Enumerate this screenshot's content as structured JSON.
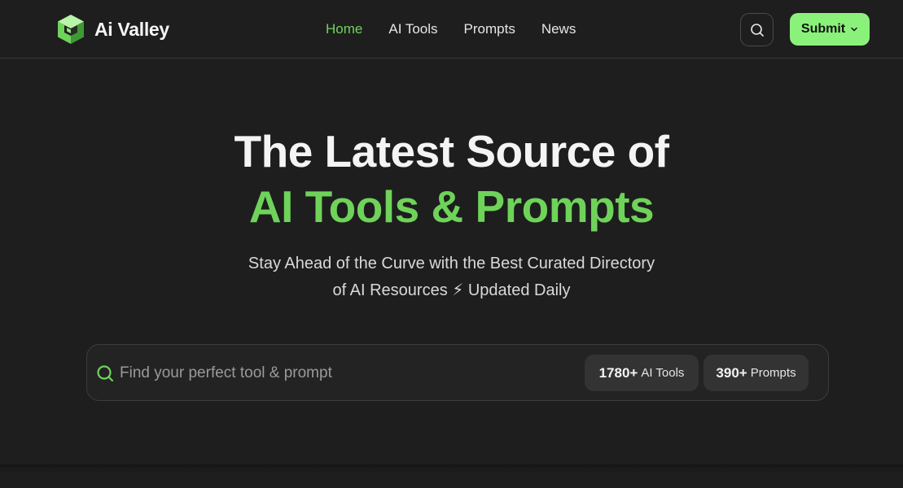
{
  "brand": {
    "name": "Ai Valley",
    "accent": "#6fd35a",
    "button_color": "#8af27a"
  },
  "nav": {
    "items": [
      {
        "label": "Home",
        "active": true
      },
      {
        "label": "AI Tools",
        "active": false
      },
      {
        "label": "Prompts",
        "active": false
      },
      {
        "label": "News",
        "active": false
      }
    ]
  },
  "header": {
    "search_icon": "search-icon",
    "submit_label": "Submit",
    "submit_icon": "chevron-down-icon"
  },
  "hero": {
    "title_line1": "The Latest Source of",
    "title_line2": "AI Tools & Prompts",
    "subtitle_line1": "Stay Ahead of the Curve with the Best Curated Directory",
    "subtitle_line2": "of AI Resources ⚡ Updated Daily"
  },
  "search": {
    "placeholder": "Find your perfect tool & prompt",
    "value": "",
    "stats": [
      {
        "count": "1780+",
        "label": "AI Tools"
      },
      {
        "count": "390+",
        "label": "Prompts"
      }
    ]
  }
}
